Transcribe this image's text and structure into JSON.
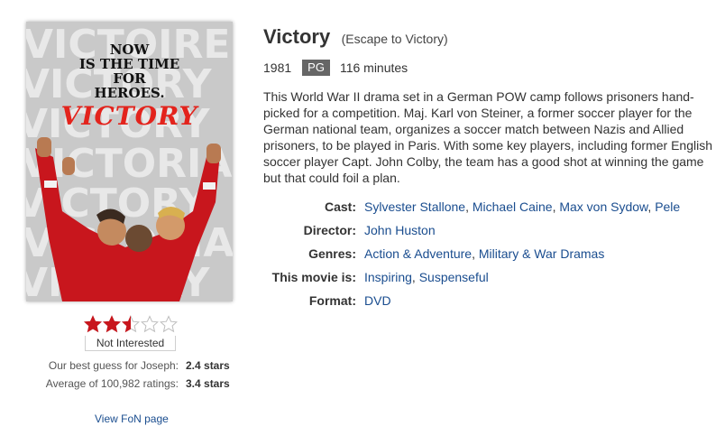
{
  "poster": {
    "bg_word_a": "VICTOIRE",
    "bg_word_b": "VICTORY",
    "bg_word_c": "VICTORIA",
    "tagline_1": "NOW",
    "tagline_2": "IS THE TIME",
    "tagline_3": "FOR",
    "tagline_4": "HEROES.",
    "title": "VICTORY",
    "accent_color": "#e3231c",
    "jersey_color": "#c8161d"
  },
  "rating": {
    "stars_filled": 2.5,
    "stars_total": 5,
    "star_color": "#c8161d",
    "not_interested_label": "Not Interested",
    "guess_label": "Our best guess for Joseph:",
    "guess_value": "2.4 stars",
    "average_label": "Average of 100,982 ratings:",
    "average_value": "3.4 stars",
    "fon_link": "View FoN page"
  },
  "movie": {
    "title": "Victory",
    "alt_title": "(Escape to Victory)",
    "year": "1981",
    "mpaa": "PG",
    "runtime": "116 minutes",
    "synopsis": "This World War II drama set in a German POW camp follows prisoners hand-picked for a competition. Maj. Karl von Steiner, a former soccer player for the German national team, organizes a soccer match between Nazis and Allied prisoners, to be played in Paris. With some key players, including former English soccer player Capt. John Colby, the team has a good shot at winning the game but that could foil a plan."
  },
  "details": {
    "cast_label": "Cast:",
    "cast": [
      "Sylvester Stallone",
      "Michael Caine",
      "Max von Sydow",
      "Pele"
    ],
    "director_label": "Director:",
    "director": [
      "John Huston"
    ],
    "genres_label": "Genres:",
    "genres": [
      "Action & Adventure",
      "Military & War Dramas"
    ],
    "mood_label": "This movie is:",
    "mood": [
      "Inspiring",
      "Suspenseful"
    ],
    "format_label": "Format:",
    "format": [
      "DVD"
    ],
    "link_color": "#1a4d8f"
  }
}
